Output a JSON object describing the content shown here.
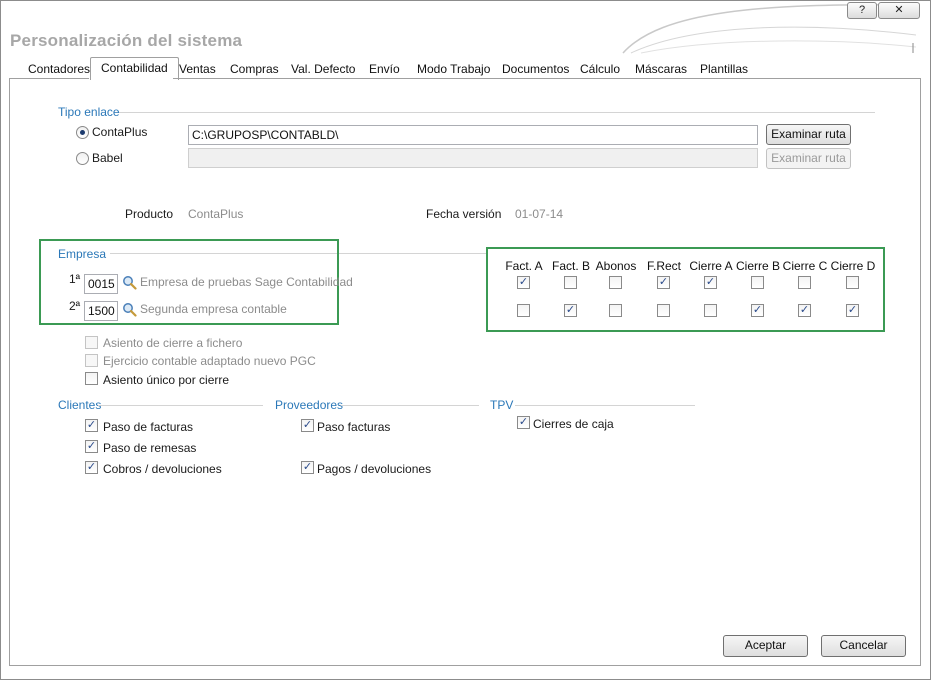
{
  "window": {
    "title": "Personalización del sistema",
    "help_label": "?",
    "close_label": "✕"
  },
  "tabs": [
    {
      "label": "Contadores"
    },
    {
      "label": "Contabilidad"
    },
    {
      "label": "Ventas"
    },
    {
      "label": "Compras"
    },
    {
      "label": "Val. Defecto"
    },
    {
      "label": "Envío"
    },
    {
      "label": "Modo Trabajo"
    },
    {
      "label": "Documentos"
    },
    {
      "label": "Cálculo"
    },
    {
      "label": "Máscaras"
    },
    {
      "label": "Plantillas"
    }
  ],
  "active_tab": "Contabilidad",
  "tipo_enlace": {
    "heading": "Tipo enlace",
    "contaplus_label": "ContaPlus",
    "contaplus_selected": true,
    "contaplus_path": "C:\\GRUPOSP\\CONTABLD\\",
    "examinar_label": "Examinar ruta",
    "babel_label": "Babel",
    "babel_selected": false,
    "babel_path": "",
    "examinar2_label": "Examinar ruta"
  },
  "info": {
    "producto_label": "Producto",
    "producto_value": "ContaPlus",
    "fecha_label": "Fecha versión",
    "fecha_value": "01-07-14"
  },
  "empresa": {
    "heading": "Empresa",
    "rows": [
      {
        "ordinal": "1ª",
        "code": "0015",
        "name": "Empresa de pruebas Sage Contabilidad"
      },
      {
        "ordinal": "2ª",
        "code": "1500",
        "name": "Segunda empresa contable"
      }
    ]
  },
  "matrix": {
    "columns": [
      "Fact. A",
      "Fact. B",
      "Abonos",
      "F.Rect",
      "Cierre A",
      "Cierre B",
      "Cierre C",
      "Cierre D"
    ],
    "rows": [
      [
        true,
        false,
        false,
        true,
        true,
        false,
        false,
        false
      ],
      [
        false,
        true,
        false,
        false,
        false,
        true,
        true,
        true
      ]
    ]
  },
  "options": [
    {
      "label": "Asiento de cierre a fichero",
      "checked": false,
      "disabled": true
    },
    {
      "label": "Ejercicio contable adaptado nuevo PGC",
      "checked": false,
      "disabled": true
    },
    {
      "label": "Asiento único por cierre",
      "checked": false,
      "disabled": false
    }
  ],
  "clientes": {
    "heading": "Clientes",
    "items": [
      {
        "label": "Paso de facturas",
        "checked": true
      },
      {
        "label": "Paso de remesas",
        "checked": true
      },
      {
        "label": "Cobros / devoluciones",
        "checked": true
      }
    ]
  },
  "proveedores": {
    "heading": "Proveedores",
    "items": [
      {
        "label": "Paso facturas",
        "checked": true
      },
      {
        "label": "Pagos / devoluciones",
        "checked": true
      }
    ]
  },
  "tpv": {
    "heading": "TPV",
    "items": [
      {
        "label": "Cierres de caja",
        "checked": true
      }
    ]
  },
  "buttons": {
    "accept": "Aceptar",
    "cancel": "Cancelar"
  },
  "colors": {
    "group_heading": "#2b78b8",
    "highlight_box": "#3b9a54",
    "title": "#a7a7a7"
  }
}
